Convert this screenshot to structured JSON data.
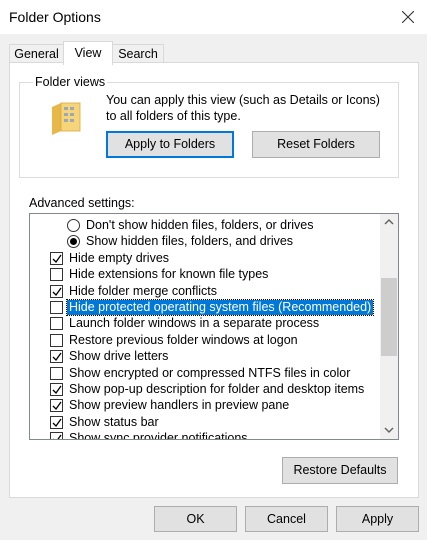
{
  "window": {
    "title": "Folder Options"
  },
  "tabs": [
    {
      "label": "General",
      "active": false
    },
    {
      "label": "View",
      "active": true
    },
    {
      "label": "Search",
      "active": false
    }
  ],
  "folder_views": {
    "label": "Folder views",
    "description": "You can apply this view (such as Details or Icons) to all folders of this type.",
    "apply_button": "Apply to Folders",
    "reset_button": "Reset Folders"
  },
  "advanced": {
    "label": "Advanced settings:",
    "items": [
      {
        "kind": "radio",
        "checked": false,
        "selected": false,
        "indent": 1,
        "text": "Don't show hidden files, folders, or drives"
      },
      {
        "kind": "radio",
        "checked": true,
        "selected": false,
        "indent": 1,
        "text": "Show hidden files, folders, and drives"
      },
      {
        "kind": "check",
        "checked": true,
        "selected": false,
        "indent": 0,
        "text": "Hide empty drives"
      },
      {
        "kind": "check",
        "checked": false,
        "selected": false,
        "indent": 0,
        "text": "Hide extensions for known file types"
      },
      {
        "kind": "check",
        "checked": true,
        "selected": false,
        "indent": 0,
        "text": "Hide folder merge conflicts"
      },
      {
        "kind": "check",
        "checked": false,
        "selected": true,
        "indent": 0,
        "text": "Hide protected operating system files (Recommended)"
      },
      {
        "kind": "check",
        "checked": false,
        "selected": false,
        "indent": 0,
        "text": "Launch folder windows in a separate process"
      },
      {
        "kind": "check",
        "checked": false,
        "selected": false,
        "indent": 0,
        "text": "Restore previous folder windows at logon"
      },
      {
        "kind": "check",
        "checked": true,
        "selected": false,
        "indent": 0,
        "text": "Show drive letters"
      },
      {
        "kind": "check",
        "checked": false,
        "selected": false,
        "indent": 0,
        "text": "Show encrypted or compressed NTFS files in color"
      },
      {
        "kind": "check",
        "checked": true,
        "selected": false,
        "indent": 0,
        "text": "Show pop-up description for folder and desktop items"
      },
      {
        "kind": "check",
        "checked": true,
        "selected": false,
        "indent": 0,
        "text": "Show preview handlers in preview pane"
      },
      {
        "kind": "check",
        "checked": true,
        "selected": false,
        "indent": 0,
        "text": "Show status bar"
      },
      {
        "kind": "check",
        "checked": true,
        "selected": false,
        "indent": 0,
        "text": "Show sync provider notifications"
      }
    ],
    "restore_defaults": "Restore Defaults"
  },
  "footer": {
    "ok": "OK",
    "cancel": "Cancel",
    "apply": "Apply"
  },
  "colors": {
    "selection": "#0078d7",
    "dialog_bg": "#f0f0f0",
    "panel_bg": "#ffffff",
    "button_bg": "#e1e1e1"
  },
  "icons": [
    "close-icon",
    "folder-icon",
    "checkmark-icon",
    "scroll-up-arrow-icon",
    "scroll-down-arrow-icon"
  ]
}
